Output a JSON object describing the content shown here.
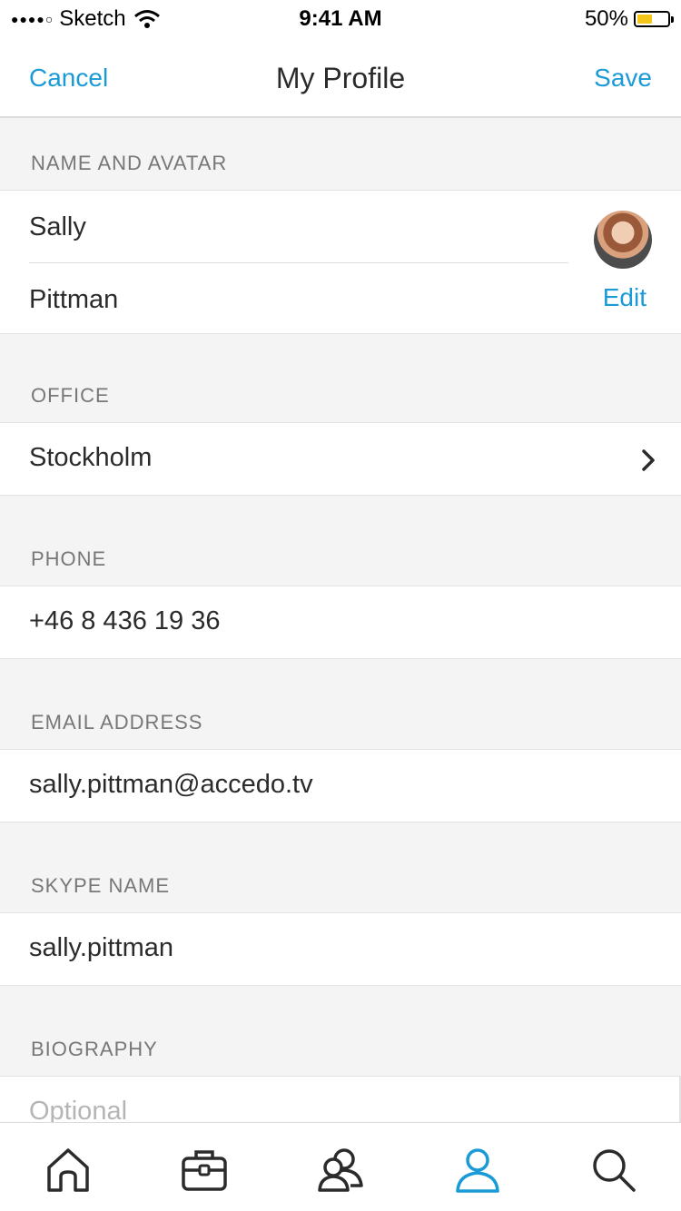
{
  "status": {
    "carrier": "Sketch",
    "time": "9:41 AM",
    "battery": "50%",
    "battery_level": 0.5
  },
  "nav": {
    "cancel": "Cancel",
    "title": "My Profile",
    "save": "Save"
  },
  "colors": {
    "accent": "#1a9ad6",
    "battery": "#f5c518"
  },
  "name_section": {
    "header": "NAME AND AVATAR",
    "first_name": "Sally",
    "last_name": "Pittman",
    "edit": "Edit"
  },
  "office": {
    "header": "OFFICE",
    "value": "Stockholm",
    "icon": "chevron-right-icon"
  },
  "phone": {
    "header": "PHONE",
    "value": "+46 8 436 19 36"
  },
  "email": {
    "header": "EMAIL ADDRESS",
    "value": "sally.pittman@accedo.tv"
  },
  "skype": {
    "header": "SKYPE NAME",
    "value": "sally.pittman"
  },
  "biography": {
    "header": "BIOGRAPHY",
    "placeholder": "Optional"
  },
  "tabs": [
    {
      "icon": "home-icon",
      "active": false
    },
    {
      "icon": "briefcase-icon",
      "active": false
    },
    {
      "icon": "people-icon",
      "active": false
    },
    {
      "icon": "profile-icon",
      "active": true
    },
    {
      "icon": "search-icon",
      "active": false
    }
  ]
}
